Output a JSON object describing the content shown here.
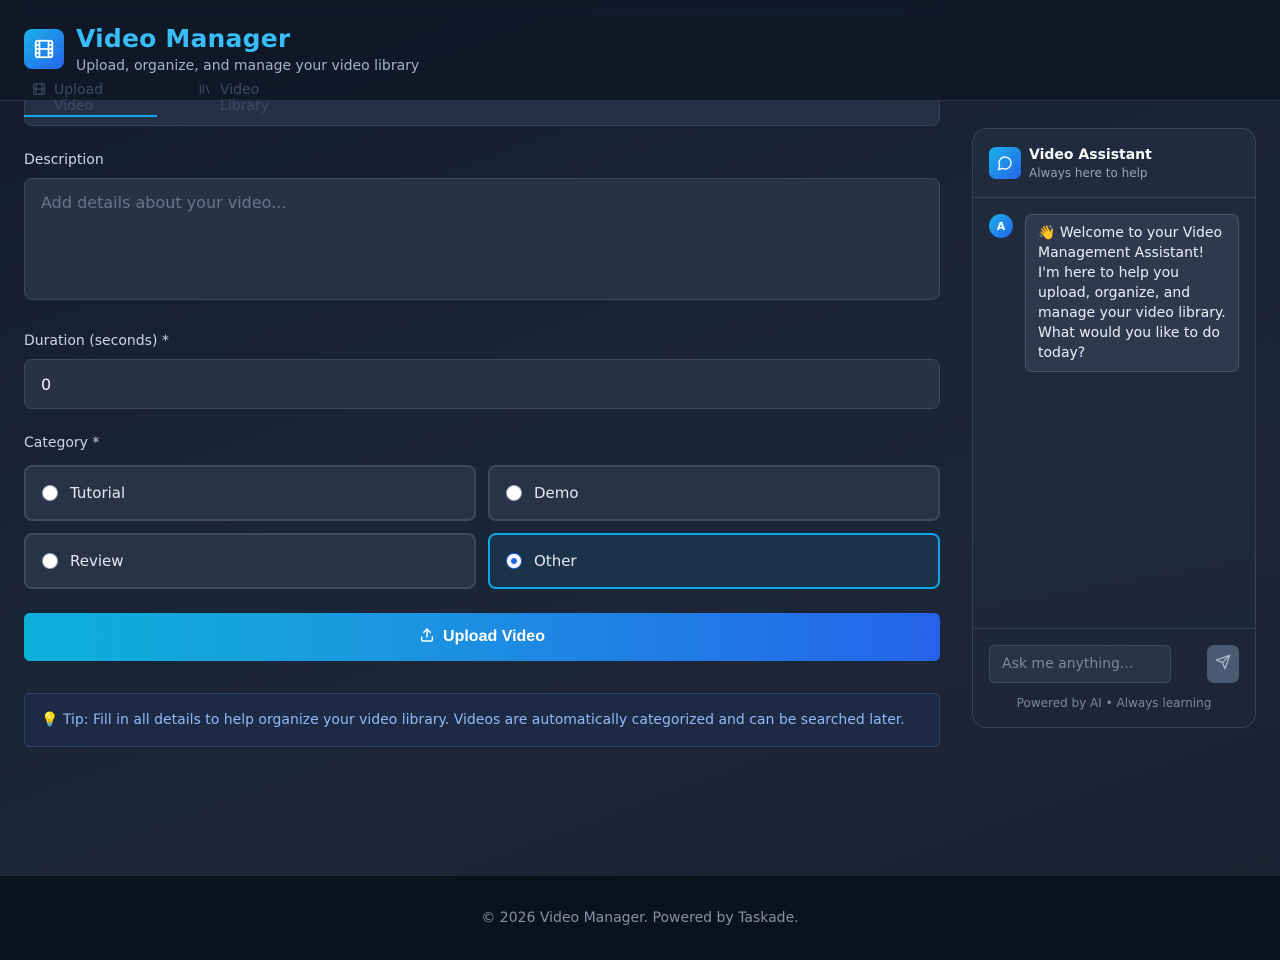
{
  "header": {
    "title": "Video Manager",
    "subtitle": "Upload, organize, and manage your video library",
    "logo_icon": "film-icon"
  },
  "tabs": [
    {
      "label": "Upload Video",
      "icon": "film-icon",
      "active": true
    },
    {
      "label": "Video Library",
      "icon": "library-icon",
      "active": false
    }
  ],
  "form": {
    "description": {
      "label": "Description",
      "placeholder": "Add details about your video...",
      "value": ""
    },
    "duration": {
      "label": "Duration (seconds) *",
      "value": "0"
    },
    "category": {
      "label": "Category *",
      "options": [
        "Tutorial",
        "Demo",
        "Review",
        "Other"
      ],
      "selected": "Other"
    },
    "submit_label": "Upload Video",
    "tip": "💡 Tip: Fill in all details to help organize your video library. Videos are automatically categorized and can be searched later."
  },
  "chat": {
    "title": "Video Assistant",
    "subtitle": "Always here to help",
    "bot_initial": "A",
    "messages": [
      {
        "from": "assistant",
        "text": "👋 Welcome to your Video Management Assistant! I'm here to help you upload, organize, and manage your video library. What would you like to do today?"
      }
    ],
    "input_placeholder": "Ask me anything...",
    "powered_by": "Powered by AI • Always learning"
  },
  "footer": {
    "text": "© 2026 Video Manager. Powered by Taskade."
  },
  "colors": {
    "accent": "#38bdf8",
    "primary_gradient_start": "#0bb0d9",
    "primary_gradient_end": "#2563eb",
    "selected_border": "#0ea5e9",
    "background": "#1a2537"
  }
}
